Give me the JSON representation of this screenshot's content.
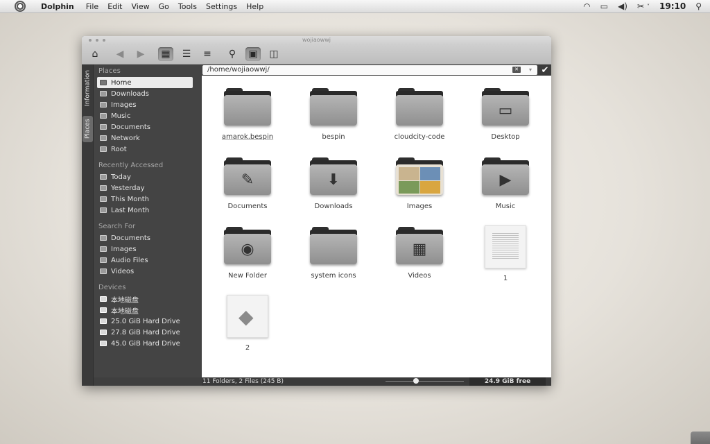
{
  "topbar": {
    "app_name": "Dolphin",
    "menu": [
      "File",
      "Edit",
      "View",
      "Go",
      "Tools",
      "Settings",
      "Help"
    ],
    "clock": "19:10"
  },
  "window": {
    "title": "wojiaowwj"
  },
  "vertical_tabs": {
    "information": "Information",
    "places": "Places"
  },
  "sidebar": {
    "places_header": "Places",
    "places": [
      "Home",
      "Downloads",
      "Images",
      "Music",
      "Documents",
      "Network",
      "Root"
    ],
    "recent_header": "Recently Accessed",
    "recent": [
      "Today",
      "Yesterday",
      "This Month",
      "Last Month"
    ],
    "search_header": "Search For",
    "search": [
      "Documents",
      "Images",
      "Audio Files",
      "Videos"
    ],
    "devices_header": "Devices",
    "devices": [
      "本地磁盘",
      "本地磁盘",
      "25.0 GiB Hard Drive",
      "27.8 GiB Hard Drive",
      "45.0 GiB Hard Drive"
    ]
  },
  "path": "/home/wojiaowwj/",
  "files": [
    {
      "name": "amarok.bespin",
      "kind": "folder",
      "icon": ""
    },
    {
      "name": "bespin",
      "kind": "folder",
      "icon": ""
    },
    {
      "name": "cloudcity-code",
      "kind": "folder",
      "icon": ""
    },
    {
      "name": "Desktop",
      "kind": "folder",
      "icon": "desktop-icon"
    },
    {
      "name": "Documents",
      "kind": "folder",
      "icon": "pen-icon"
    },
    {
      "name": "Downloads",
      "kind": "folder",
      "icon": "download-arrow-icon"
    },
    {
      "name": "Images",
      "kind": "images",
      "icon": "images-folder-icon"
    },
    {
      "name": "Music",
      "kind": "folder",
      "icon": "play-icon"
    },
    {
      "name": "New Folder",
      "kind": "folder",
      "icon": "camera-icon"
    },
    {
      "name": "system icons",
      "kind": "folder",
      "icon": ""
    },
    {
      "name": "Videos",
      "kind": "folder",
      "icon": "film-icon"
    },
    {
      "name": "1",
      "kind": "text",
      "icon": "text-document-icon"
    },
    {
      "name": "2",
      "kind": "shape",
      "icon": "shape-document-icon"
    }
  ],
  "status": {
    "summary": "11 Folders, 2 Files (245 B)",
    "zoom_fraction": 0.38,
    "free_space": "24.9 GiB free"
  }
}
